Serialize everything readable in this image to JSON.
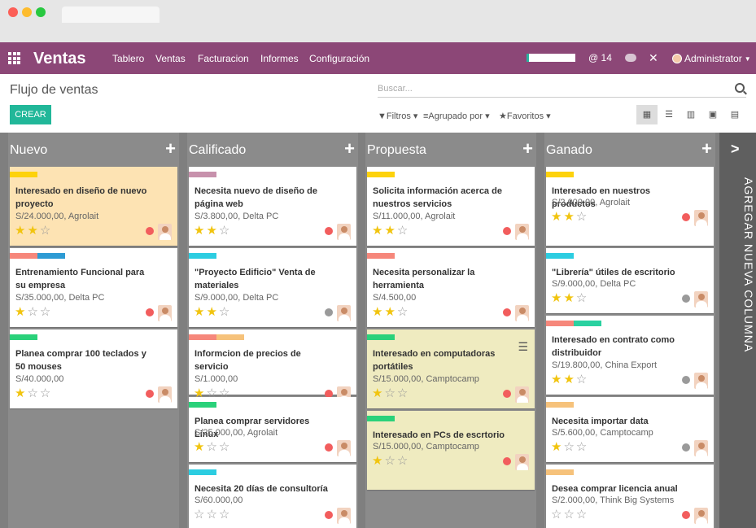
{
  "colors": {
    "navbar": "#8c4777",
    "accent": "#21b799",
    "card_highlight_orange": "#fde3b3",
    "card_highlight_yellow": "#efebc0"
  },
  "navbar": {
    "app_title": "Ventas",
    "menu": [
      "Tablero",
      "Ventas",
      "Facturacion",
      "Informes",
      "Configuración"
    ],
    "mentions": "14",
    "user": "Administrator"
  },
  "control": {
    "breadcrumb": "Flujo de ventas",
    "create": "CREAR",
    "search_placeholder": "Buscar...",
    "filters": "Filtros",
    "group_by": "Agrupado por",
    "favorites": "Favoritos"
  },
  "add_column": "AGREGAR NUEVA COLUMNA",
  "columns": [
    {
      "title": "Nuevo",
      "cards": [
        {
          "title": "Interesado en diseño de nuevo proyecto",
          "amount": "S/24.000,00, Agrolait",
          "stars": 2,
          "status": "#f25d5d",
          "tags": [
            "#fdd20c"
          ],
          "bg": "#fde3b3"
        },
        {
          "title": "Entrenamiento Funcional para su empresa",
          "amount": "S/35.000,00, Delta PC",
          "stars": 1,
          "status": "#f25d5d",
          "tags": [
            "#f6877b",
            "#2d9bd4"
          ],
          "bg": "#fff"
        },
        {
          "title": "Planea comprar 100 teclados y 50 mouses",
          "amount": "S/40.000,00",
          "stars": 1,
          "status": "#f25d5d",
          "tags": [
            "#2ad17a"
          ],
          "bg": "#fff"
        }
      ]
    },
    {
      "title": "Calificado",
      "cards": [
        {
          "title": "Necesita nuevo de diseño de página web",
          "amount": "S/3.800,00, Delta PC",
          "stars": 2,
          "status": "#f25d5d",
          "tags": [
            "#c791ac"
          ],
          "bg": "#fff"
        },
        {
          "title": "\"Proyecto Edificio\" Venta de materiales",
          "amount": "S/9.000,00, Delta PC",
          "stars": 2,
          "status": "#9a9a9a",
          "tags": [
            "#2ccde1"
          ],
          "bg": "#fff"
        },
        {
          "title": "Informcion de precios de servicio",
          "amount": "S/1.000,00",
          "stars": 1,
          "status": "#f25d5d",
          "tags": [
            "#f6877b",
            "#f6c27b"
          ],
          "bg": "#fff"
        },
        {
          "title": "Planea comprar servidores Linux",
          "amount": "S/25.000,00, Agrolait",
          "stars": 1,
          "status": "#f25d5d",
          "tags": [
            "#2ad17a"
          ],
          "bg": "#fff"
        },
        {
          "title": "Necesita 20 días de consultoría",
          "amount": "S/60.000,00",
          "stars": 0,
          "status": "#f25d5d",
          "tags": [
            "#2ccde1"
          ],
          "bg": "#fff"
        }
      ]
    },
    {
      "title": "Propuesta",
      "cards": [
        {
          "title": "Solicita información acerca de nuestros servicios",
          "amount": "S/11.000,00, Agrolait",
          "stars": 2,
          "status": "#f25d5d",
          "tags": [
            "#fdd20c"
          ],
          "bg": "#fff"
        },
        {
          "title": "Necesita personalizar la herramienta",
          "amount": "S/4.500,00",
          "stars": 2,
          "status": "#f25d5d",
          "tags": [
            "#f6877b"
          ],
          "bg": "#fff"
        },
        {
          "title": "Interesado en computadoras portátiles",
          "amount": "S/15.000,00, Camptocamp",
          "stars": 1,
          "status": "#f25d5d",
          "tags": [
            "#2ad17a"
          ],
          "bg": "#efebc0",
          "menu": true
        },
        {
          "title": "Interesado en PCs de escrtorio",
          "amount": "S/15.000,00, Camptocamp",
          "stars": 1,
          "status": "#f25d5d",
          "tags": [
            "#2ad17a"
          ],
          "bg": "#efebc0"
        }
      ]
    },
    {
      "title": "Ganado",
      "cards": [
        {
          "title": "Interesado en nuestros productos",
          "amount": "S/2.000,00, Agrolait",
          "stars": 2,
          "status": "#f25d5d",
          "tags": [
            "#fdd20c"
          ],
          "bg": "#fff"
        },
        {
          "title": "\"Librería\" útiles de escritorio",
          "amount": "S/9.000,00, Delta PC",
          "stars": 2,
          "status": "#9a9a9a",
          "tags": [
            "#2ccde1"
          ],
          "bg": "#fff"
        },
        {
          "title": "Interesado en contrato como distribuidor",
          "amount": "S/19.800,00, China Export",
          "stars": 2,
          "status": "#9a9a9a",
          "tags": [
            "#f6877b",
            "#2ad1a0"
          ],
          "bg": "#fff"
        },
        {
          "title": "Necesita importar data",
          "amount": "S/5.600,00, Camptocamp",
          "stars": 1,
          "status": "#9a9a9a",
          "tags": [
            "#f6c27b"
          ],
          "bg": "#fff"
        },
        {
          "title": "Desea comprar licencia anual",
          "amount": "S/2.000,00, Think Big Systems",
          "stars": 0,
          "status": "#f25d5d",
          "tags": [
            "#f6c27b"
          ],
          "bg": "#fff"
        }
      ]
    }
  ]
}
